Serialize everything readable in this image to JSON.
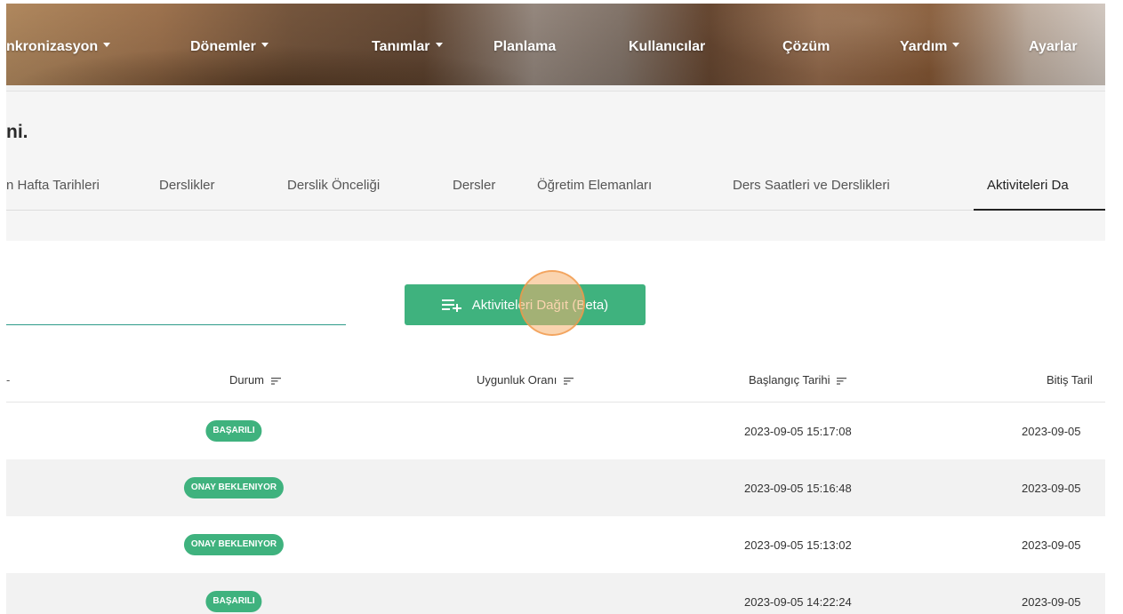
{
  "navbar": {
    "items": [
      {
        "label": "nkronizasyon",
        "dropdown": true
      },
      {
        "label": "Dönemler",
        "dropdown": true
      },
      {
        "label": "Tanımlar",
        "dropdown": true
      },
      {
        "label": "Planlama",
        "dropdown": false
      },
      {
        "label": "Kullanıcılar",
        "dropdown": false
      },
      {
        "label": "Çözüm",
        "dropdown": false
      },
      {
        "label": "Yardım",
        "dropdown": true
      },
      {
        "label": "Ayarlar",
        "dropdown": false
      }
    ]
  },
  "page": {
    "title": "ni."
  },
  "tabs": [
    {
      "label": "n Hafta Tarihleri",
      "active": false
    },
    {
      "label": "Derslikler",
      "active": false
    },
    {
      "label": "Derslik Önceliği",
      "active": false
    },
    {
      "label": "Dersler",
      "active": false
    },
    {
      "label": "Öğretim Elemanları",
      "active": false
    },
    {
      "label": "Ders Saatleri ve Derslikleri",
      "active": false
    },
    {
      "label": "Aktiviteleri Da",
      "active": true
    }
  ],
  "toolbar": {
    "distribute_label": "Aktiviteleri Dağıt (Beta)",
    "distribute_icon": "playlist-add-icon"
  },
  "table": {
    "columns": [
      "Durum",
      "Uygunluk Oranı",
      "Başlangıç Tarihi",
      "Bitiş Taril"
    ],
    "rows": [
      {
        "status": "BAŞARILI",
        "start": "2023-09-05 15:17:08",
        "end": "2023-09-05"
      },
      {
        "status": "ONAY BEKLENIYOR",
        "start": "2023-09-05 15:16:48",
        "end": "2023-09-05"
      },
      {
        "status": "ONAY BEKLENIYOR",
        "start": "2023-09-05 15:13:02",
        "end": "2023-09-05"
      },
      {
        "status": "BAŞARILI",
        "start": "2023-09-05 14:22:24",
        "end": "2023-09-05"
      }
    ]
  },
  "colors": {
    "accent_green": "#3fb27e",
    "search_underline": "#2f9b8a",
    "click_highlight": "#f6b06e"
  }
}
